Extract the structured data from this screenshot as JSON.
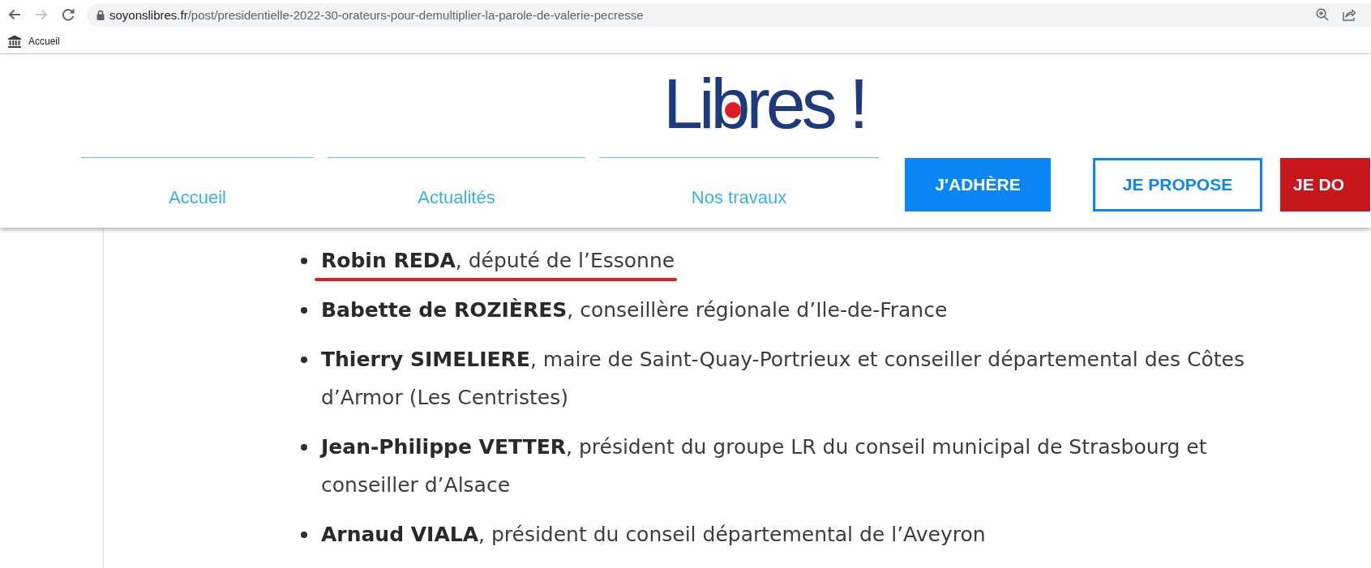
{
  "browser": {
    "nav_buttons": [
      {
        "kind": "back",
        "disabled": false
      },
      {
        "kind": "forward",
        "disabled": true
      },
      {
        "kind": "reload",
        "disabled": false
      }
    ],
    "address": {
      "host": "soyonslibres.fr",
      "path": "/post/presidentielle-2022-30-orateurs-pour-demultiplier-la-parole-de-valerie-pecresse"
    },
    "toolbar_icons": [
      {
        "kind": "zoom"
      },
      {
        "kind": "share"
      }
    ],
    "bookmarks": [
      {
        "label": "Accueil"
      }
    ]
  },
  "header": {
    "logo": "Libres !",
    "nav_links": [
      {
        "label": "Accueil"
      },
      {
        "label": "Actualités"
      },
      {
        "label": "Nos travaux"
      }
    ],
    "buttons": [
      {
        "label": "J'ADHÈRE",
        "kind": "primary"
      },
      {
        "label": "JE PROPOSE",
        "kind": "outlined"
      },
      {
        "label": "JE DO",
        "kind": "accent"
      }
    ]
  },
  "speakers": [
    {
      "text": "**Robin REDA**, député de l’Essonne",
      "underlined": true
    },
    {
      "text": "**Babette de ROZIÈRES**, conseillère régionale d’Ile-de-France",
      "underlined": false
    },
    {
      "text": "**Thierry SIMELIERE**, maire de Saint-Quay-Portrieux et conseiller départemental des Côtes d’Armor (Les Centristes)",
      "underlined": false
    },
    {
      "text": "**Jean-Philippe VETTER**, président du groupe LR du conseil municipal de Strasbourg et conseiller d’Alsace",
      "underlined": false
    },
    {
      "text": "**Arnaud VIALA**, président du conseil départemental de l’Aveyron",
      "underlined": false
    }
  ]
}
